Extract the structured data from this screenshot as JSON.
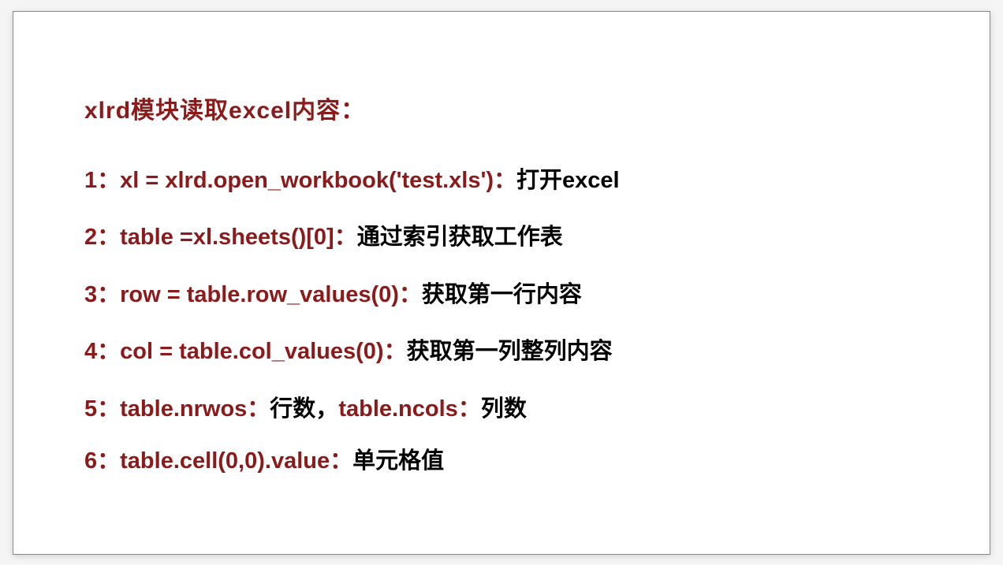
{
  "title": "xlrd模块读取excel内容：",
  "lines": [
    {
      "num": "1：",
      "code": "xl = xlrd.open_workbook('test.xls')：",
      "desc": "打开excel"
    },
    {
      "num": "2：",
      "code": "table =xl.sheets()[0]：",
      "desc": "通过索引获取工作表"
    },
    {
      "num": "3：",
      "code": "row = table.row_values(0)：",
      "desc": "获取第一行内容"
    },
    {
      "num": "4：",
      "code": "col = table.col_values(0)：",
      "desc": "获取第一列整列内容"
    },
    {
      "num": "5：",
      "code1": "table.nrwos：",
      "desc1": "行数，",
      "code2": "table.ncols：",
      "desc2": "列数"
    },
    {
      "num": "6：",
      "code": "table.cell(0,0).value：",
      "desc": "单元格值"
    }
  ]
}
